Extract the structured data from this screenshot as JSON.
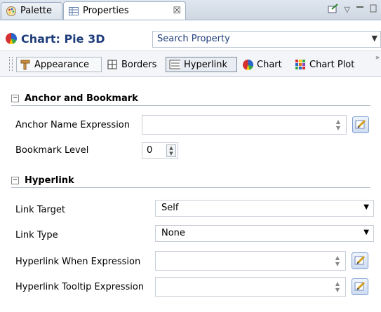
{
  "tabs": {
    "palette": "Palette",
    "properties": "Properties",
    "close": "☒"
  },
  "title": {
    "chart": "Chart: Pie 3D",
    "search_placeholder": "Search Property"
  },
  "categories": [
    {
      "label": "Appearance",
      "icon": "appearance-icon"
    },
    {
      "label": "Borders",
      "icon": "borders-icon"
    },
    {
      "label": "Hyperlink",
      "icon": "hyperlink-icon",
      "selected": true
    },
    {
      "label": "Chart",
      "icon": "chart-icon"
    },
    {
      "label": "Chart Plot",
      "icon": "chart-plot-icon"
    }
  ],
  "anchor": {
    "heading": "Anchor and Bookmark",
    "anchor_label": "Anchor Name Expression",
    "anchor_value": "",
    "bookmark_label": "Bookmark Level",
    "bookmark_value": "0"
  },
  "hyperlink": {
    "heading": "Hyperlink",
    "target_label": "Link Target",
    "target_value": "Self",
    "type_label": "Link Type",
    "type_value": "None",
    "when_label": "Hyperlink When Expression",
    "when_value": "",
    "tooltip_label": "Hyperlink Tooltip Expression",
    "tooltip_value": ""
  }
}
